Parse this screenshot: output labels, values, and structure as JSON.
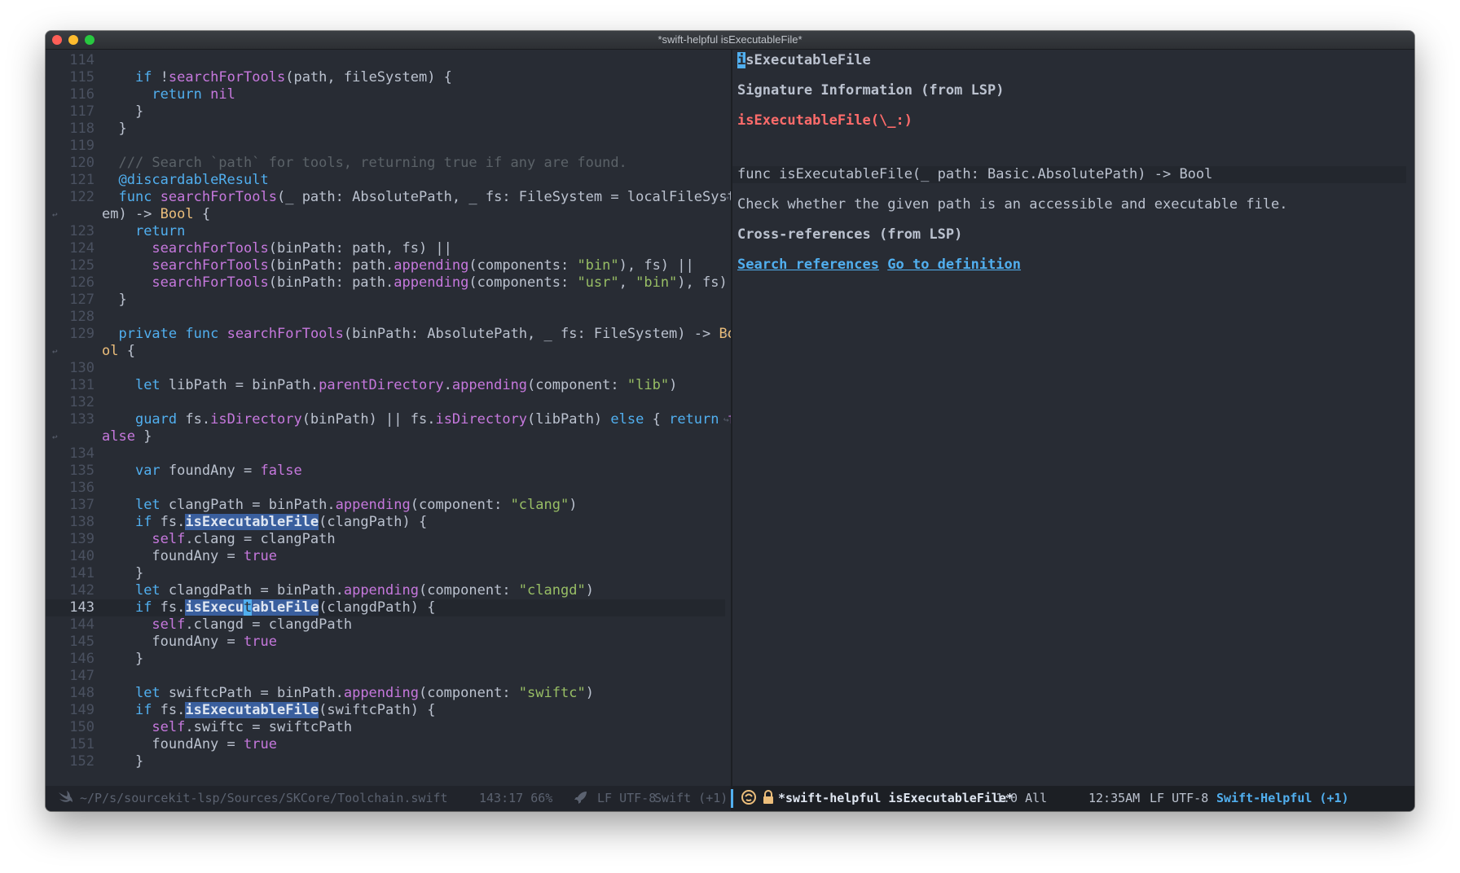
{
  "window": {
    "title": "*swift-helpful isExecutableFile*"
  },
  "editor": {
    "lines": [
      {
        "n": "114",
        "segs": []
      },
      {
        "n": "115",
        "segs": [
          [
            "    ",
            ""
          ],
          [
            "if",
            "k"
          ],
          [
            " !",
            ""
          ],
          [
            "searchForTools",
            "f"
          ],
          [
            "(path, fileSystem) {",
            ""
          ]
        ]
      },
      {
        "n": "116",
        "segs": [
          [
            "      ",
            ""
          ],
          [
            "return",
            "k"
          ],
          [
            " ",
            ""
          ],
          [
            "nil",
            "f"
          ]
        ]
      },
      {
        "n": "117",
        "segs": [
          [
            "    }",
            ""
          ]
        ]
      },
      {
        "n": "118",
        "segs": [
          [
            "  }",
            ""
          ]
        ]
      },
      {
        "n": "119",
        "segs": []
      },
      {
        "n": "120",
        "segs": [
          [
            "  /// Search `path` for tools, returning true if any are found.",
            "c"
          ]
        ]
      },
      {
        "n": "121",
        "segs": [
          [
            "  ",
            ""
          ],
          [
            "@discardableResult",
            "k"
          ]
        ]
      },
      {
        "n": "122",
        "segs": [
          [
            "  ",
            ""
          ],
          [
            "func",
            "k"
          ],
          [
            " ",
            ""
          ],
          [
            "searchForTools",
            "f"
          ],
          [
            "(_ path: AbsolutePath, _ fs: FileSystem = localFileSyst",
            ""
          ]
        ],
        "wrap": "right"
      },
      {
        "n": "",
        "segs": [
          [
            "em) -> ",
            ""
          ],
          [
            "Bool",
            "t"
          ],
          [
            " {",
            ""
          ]
        ],
        "wrap": "left"
      },
      {
        "n": "123",
        "segs": [
          [
            "    ",
            ""
          ],
          [
            "return",
            "k"
          ]
        ]
      },
      {
        "n": "124",
        "segs": [
          [
            "      ",
            ""
          ],
          [
            "searchForTools",
            "f"
          ],
          [
            "(binPath: path, fs) ||",
            ""
          ]
        ]
      },
      {
        "n": "125",
        "segs": [
          [
            "      ",
            ""
          ],
          [
            "searchForTools",
            "f"
          ],
          [
            "(binPath: path.",
            ""
          ],
          [
            "appending",
            "f"
          ],
          [
            "(components: ",
            ""
          ],
          [
            "\"bin\"",
            "s"
          ],
          [
            "), fs) ||",
            ""
          ]
        ]
      },
      {
        "n": "126",
        "segs": [
          [
            "      ",
            ""
          ],
          [
            "searchForTools",
            "f"
          ],
          [
            "(binPath: path.",
            ""
          ],
          [
            "appending",
            "f"
          ],
          [
            "(components: ",
            ""
          ],
          [
            "\"usr\"",
            "s"
          ],
          [
            ", ",
            ""
          ],
          [
            "\"bin\"",
            "s"
          ],
          [
            "), fs)",
            ""
          ]
        ]
      },
      {
        "n": "127",
        "segs": [
          [
            "  }",
            ""
          ]
        ]
      },
      {
        "n": "128",
        "segs": []
      },
      {
        "n": "129",
        "segs": [
          [
            "  ",
            ""
          ],
          [
            "private",
            "k"
          ],
          [
            " ",
            ""
          ],
          [
            "func",
            "k"
          ],
          [
            " ",
            ""
          ],
          [
            "searchForTools",
            "f"
          ],
          [
            "(binPath: AbsolutePath, _ fs: FileSystem) -> ",
            ""
          ],
          [
            "Bo",
            "t"
          ]
        ],
        "wrap": "right"
      },
      {
        "n": "",
        "segs": [
          [
            "ol",
            "t"
          ],
          [
            " {",
            ""
          ]
        ],
        "wrap": "left"
      },
      {
        "n": "130",
        "segs": []
      },
      {
        "n": "131",
        "segs": [
          [
            "    ",
            ""
          ],
          [
            "let",
            "k"
          ],
          [
            " libPath = binPath.",
            ""
          ],
          [
            "parentDirectory",
            "f"
          ],
          [
            ".",
            ""
          ],
          [
            "appending",
            "f"
          ],
          [
            "(component: ",
            ""
          ],
          [
            "\"lib\"",
            "s"
          ],
          [
            ")",
            ""
          ]
        ]
      },
      {
        "n": "132",
        "segs": []
      },
      {
        "n": "133",
        "segs": [
          [
            "    ",
            ""
          ],
          [
            "guard",
            "k"
          ],
          [
            " fs.",
            ""
          ],
          [
            "isDirectory",
            "f"
          ],
          [
            "(binPath) || fs.",
            ""
          ],
          [
            "isDirectory",
            "f"
          ],
          [
            "(libPath) ",
            ""
          ],
          [
            "else",
            "k"
          ],
          [
            " { ",
            ""
          ],
          [
            "return",
            "k"
          ],
          [
            " f",
            "f"
          ]
        ],
        "wrap": "right"
      },
      {
        "n": "",
        "segs": [
          [
            "alse",
            "f"
          ],
          [
            " }",
            ""
          ]
        ],
        "wrap": "left"
      },
      {
        "n": "134",
        "segs": []
      },
      {
        "n": "135",
        "segs": [
          [
            "    ",
            ""
          ],
          [
            "var",
            "k"
          ],
          [
            " foundAny = ",
            ""
          ],
          [
            "false",
            "f"
          ]
        ]
      },
      {
        "n": "136",
        "segs": []
      },
      {
        "n": "137",
        "segs": [
          [
            "    ",
            ""
          ],
          [
            "let",
            "k"
          ],
          [
            " clangPath = binPath.",
            ""
          ],
          [
            "appending",
            "f"
          ],
          [
            "(component: ",
            ""
          ],
          [
            "\"clang\"",
            "s"
          ],
          [
            ")",
            ""
          ]
        ]
      },
      {
        "n": "138",
        "segs": [
          [
            "    ",
            ""
          ],
          [
            "if",
            "k"
          ],
          [
            " fs.",
            ""
          ],
          [
            "isExecutableFile",
            "hl"
          ],
          [
            "(clangPath) {",
            ""
          ]
        ]
      },
      {
        "n": "139",
        "segs": [
          [
            "      ",
            ""
          ],
          [
            "self",
            "f"
          ],
          [
            ".clang = clangPath",
            ""
          ]
        ]
      },
      {
        "n": "140",
        "segs": [
          [
            "      foundAny = ",
            ""
          ],
          [
            "true",
            "f"
          ]
        ]
      },
      {
        "n": "141",
        "segs": [
          [
            "    }",
            ""
          ]
        ]
      },
      {
        "n": "142",
        "segs": [
          [
            "    ",
            ""
          ],
          [
            "let",
            "k"
          ],
          [
            " clangdPath = binPath.",
            ""
          ],
          [
            "appending",
            "f"
          ],
          [
            "(component: ",
            ""
          ],
          [
            "\"clangd\"",
            "s"
          ],
          [
            ")",
            ""
          ]
        ]
      },
      {
        "n": "143",
        "segs": [
          [
            "    ",
            ""
          ],
          [
            "if",
            "k"
          ],
          [
            " fs.",
            ""
          ],
          [
            "isExecu",
            "hl"
          ],
          [
            "t",
            "cur"
          ],
          [
            "ableFile",
            "hl"
          ],
          [
            "(clangdPath) {",
            ""
          ]
        ],
        "current": true
      },
      {
        "n": "144",
        "segs": [
          [
            "      ",
            ""
          ],
          [
            "self",
            "f"
          ],
          [
            ".clangd = clangdPath",
            ""
          ]
        ]
      },
      {
        "n": "145",
        "segs": [
          [
            "      foundAny = ",
            ""
          ],
          [
            "true",
            "f"
          ]
        ]
      },
      {
        "n": "146",
        "segs": [
          [
            "    }",
            ""
          ]
        ]
      },
      {
        "n": "147",
        "segs": []
      },
      {
        "n": "148",
        "segs": [
          [
            "    ",
            ""
          ],
          [
            "let",
            "k"
          ],
          [
            " swiftcPath = binPath.",
            ""
          ],
          [
            "appending",
            "f"
          ],
          [
            "(component: ",
            ""
          ],
          [
            "\"swiftc\"",
            "s"
          ],
          [
            ")",
            ""
          ]
        ]
      },
      {
        "n": "149",
        "segs": [
          [
            "    ",
            ""
          ],
          [
            "if",
            "k"
          ],
          [
            " fs.",
            ""
          ],
          [
            "isExecutableFile",
            "hl"
          ],
          [
            "(swiftcPath) {",
            ""
          ]
        ]
      },
      {
        "n": "150",
        "segs": [
          [
            "      ",
            ""
          ],
          [
            "self",
            "f"
          ],
          [
            ".swiftc = swiftcPath",
            ""
          ]
        ]
      },
      {
        "n": "151",
        "segs": [
          [
            "      foundAny = ",
            ""
          ],
          [
            "true",
            "f"
          ]
        ]
      },
      {
        "n": "152",
        "segs": [
          [
            "    }",
            ""
          ]
        ]
      }
    ]
  },
  "help": {
    "cursor_char": "i",
    "title_rest": "sExecutableFile",
    "signature_heading": "Signature Information (from LSP)",
    "symbol": "isExecutableFile(\\_:)",
    "signature": "func isExecutableFile(_ path: Basic.AbsolutePath) -> Bool",
    "description": "Check whether the given path is an accessible and executable file.",
    "xref_heading": "Cross-references (from LSP)",
    "search_refs": "Search references",
    "goto_def": "Go to definition"
  },
  "modeline_left": {
    "path": "~/P/s/sourcekit-lsp/Sources/SKCore/Toolchain.swift",
    "position": "143:17 66%",
    "encoding": "LF UTF-8",
    "major_mode": "Swift (+1)"
  },
  "modeline_right": {
    "buffer": "*swift-helpful isExecutableFile*",
    "position": "1:0 All",
    "time": "12:35AM",
    "encoding": "LF UTF-8",
    "major_mode": "Swift-Helpful (+1)"
  },
  "colors": {
    "background": "#282c34",
    "keyword": "#51afef",
    "function": "#c678dd",
    "string": "#98be65",
    "comment": "#5b6268",
    "type": "#ecbe7b",
    "error": "#ff6c6b"
  }
}
